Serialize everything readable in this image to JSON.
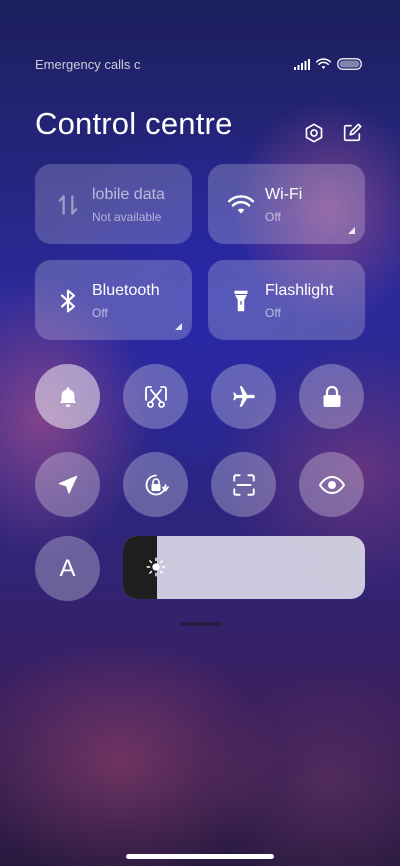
{
  "status_bar": {
    "carrier_text": "Emergency calls c",
    "icons": [
      "signal-icon",
      "wifi-icon",
      "battery-icon"
    ]
  },
  "header": {
    "title": "Control centre",
    "icons": [
      "settings-icon",
      "edit-icon"
    ]
  },
  "tiles": [
    {
      "name": "Mobile data",
      "shown": "lobile data",
      "status": "Not available",
      "icon": "mobile-data-icon"
    },
    {
      "name": "Wi-Fi",
      "status": "Off",
      "icon": "wifi-icon"
    },
    {
      "name": "Bluetooth",
      "status": "Off",
      "icon": "bluetooth-icon"
    },
    {
      "name": "Flashlight",
      "status": "Off",
      "icon": "flashlight-icon"
    }
  ],
  "toggles_row1": [
    "notification-bell-icon",
    "screenshot-icon",
    "airplane-mode-icon",
    "lock-icon"
  ],
  "toggles_row2": [
    "location-icon",
    "rotation-lock-icon",
    "scanner-icon",
    "reading-mode-icon"
  ],
  "auto_brightness": {
    "label": "A"
  },
  "brightness": {
    "level": 0.14,
    "icon": "brightness-icon"
  },
  "colors": {
    "tile_bg": "rgba(255,255,255,0.22)",
    "brightness_track": "#e6e6f0",
    "brightness_fill": "#1e1e1e"
  }
}
